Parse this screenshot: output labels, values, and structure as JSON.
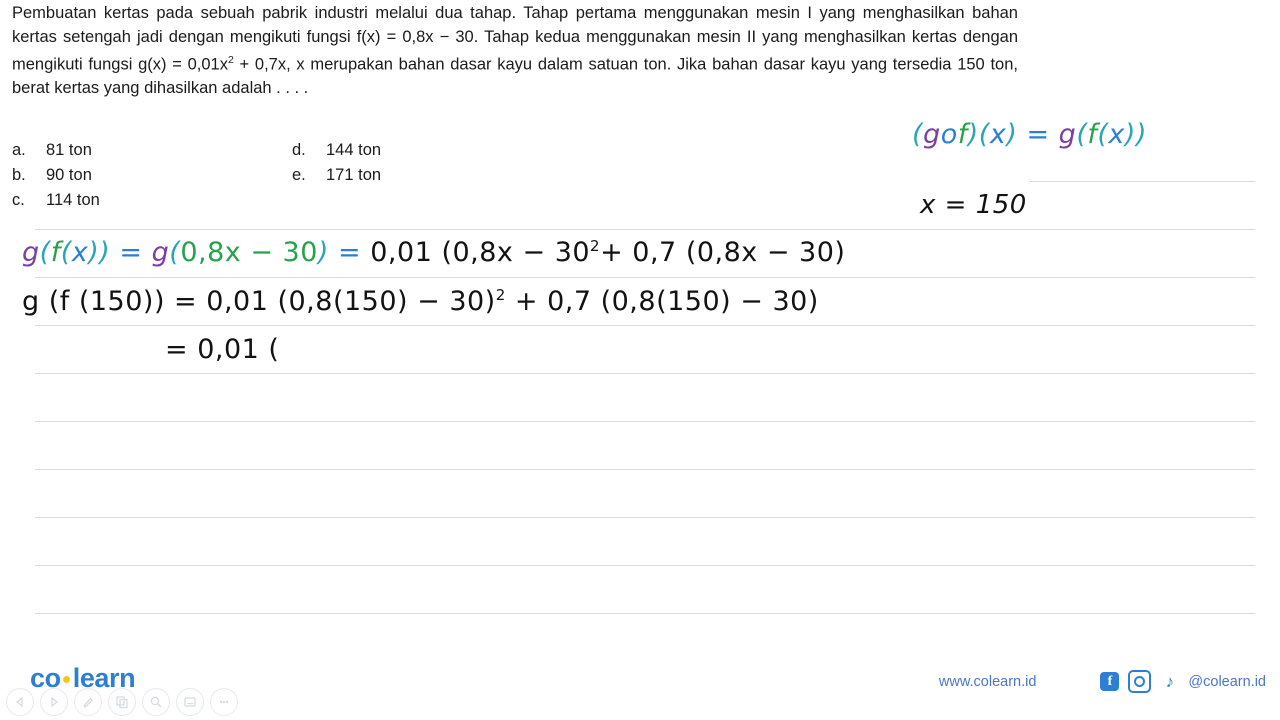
{
  "question": {
    "lines": [
      "Pembuatan kertas pada sebuah pabrik industri melalui dua tahap. Tahap pertama menggunakan mesin I yang menghasilkan bahan kertas setengah jadi dengan mengikuti fungsi f(x) = 0,8x − 30.",
      "Tahap kedua menggunakan mesin II yang menghasilkan kertas dengan mengikuti fungsi g(x) = 0,01x² + 0,7x, x merupakan bahan dasar kayu dalam satuan ton. Jika bahan dasar kayu yang tersedia 150 ton, berat kertas yang dihasilkan adalah . . . ."
    ],
    "para1_part1": "Pembuatan kertas pada sebuah pabrik industri melalui dua tahap. Tahap pertama menggunakan mesin I yang menghasilkan bahan kertas setengah jadi dengan mengikuti fungsi f(x) = 0,8x − 30. Tahap kedua menggunakan mesin II yang menghasilkan kertas dengan mengikuti fungsi g(x) = 0,01x",
    "para1_sup": "2",
    "para1_part2": " + 0,7x, x merupakan bahan dasar kayu dalam satuan ton. Jika bahan dasar kayu yang tersedia 150 ton, berat kertas yang dihasilkan adalah . . . ."
  },
  "options": {
    "left": [
      {
        "key": "a.",
        "value": "81 ton"
      },
      {
        "key": "b.",
        "value": "90 ton"
      },
      {
        "key": "c.",
        "value": "114 ton"
      }
    ],
    "right": [
      {
        "key": "d.",
        "value": "144 ton"
      },
      {
        "key": "e.",
        "value": "171 ton"
      }
    ]
  },
  "handwriting": {
    "composition": {
      "p_open": "(",
      "g": "g",
      "o": "o",
      "f": "f",
      "p_close": ")",
      "x_open": "(",
      "x": "x",
      "x_close": ")",
      "equals": "=",
      "g2": "g",
      "p2_open": "(",
      "f2": "f",
      "p3_open": "(",
      "x2": "x",
      "p3_close": ")",
      "p2_close": ")"
    },
    "given": "x = 150",
    "line1": {
      "g": "g",
      "open": "(",
      "f": "f",
      "xopen": "(",
      "x": "x",
      "xclose": ")",
      "close": ")",
      "eq1": "=",
      "g2": "g",
      "open2": "(",
      "inner": "0,8x − 30",
      "close2": ")",
      "eq2": "=",
      "rest_a": "0,01 (0,8x − 30",
      "rest_sup": "2",
      "rest_b": "+ 0,7 (0,8x − 30)"
    },
    "line2": {
      "a": "g (f (150)) = 0,01 (0,8(150) − 30)",
      "sup": "2",
      "b": " + 0,7 (0,8(150) − 30)"
    },
    "line3": "= 0,01 ("
  },
  "footer": {
    "logo_co": "co",
    "logo_learn": "learn",
    "site_url": "www.colearn.id",
    "handle": "@colearn.id",
    "facebook_glyph": "f",
    "tiktok_glyph": "♪",
    "toolbar": [
      "prev-icon",
      "play-icon",
      "pen-icon",
      "copy-icon",
      "search-icon",
      "book-icon",
      "more-icon"
    ]
  },
  "colors": {
    "brand_blue": "#2d7fd3",
    "logo_dot": "#f5c518",
    "ink_purple": "#7b3fa0",
    "ink_green": "#27a24a",
    "ink_teal": "#2aa5b5",
    "ink_blue": "#2a7fd4",
    "rule": "#d9d9d9"
  }
}
